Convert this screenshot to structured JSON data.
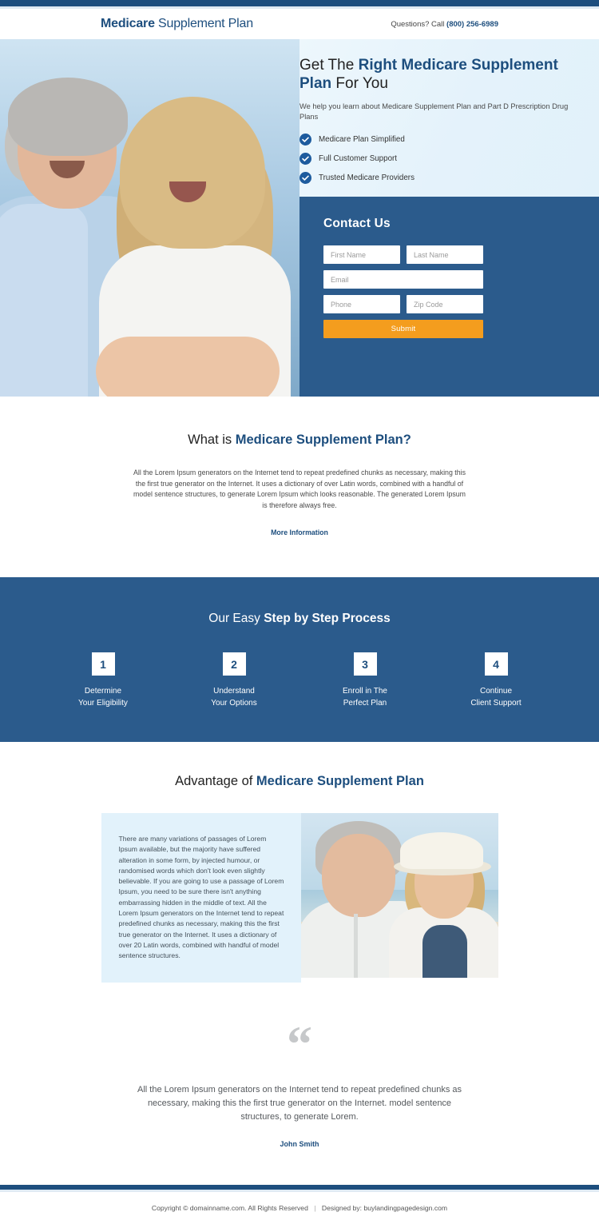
{
  "header": {
    "logo_bold": "Medicare",
    "logo_light": " Supplement Plan",
    "phone_prefix": "Questions? Call ",
    "phone_number": "(800) 256-6989"
  },
  "hero": {
    "title_part1": "Get The ",
    "title_highlight1": "Right Medicare Supplement Plan",
    "title_part2": " For You",
    "subtitle": "We help you learn about Medicare Supplement Plan and Part D Prescription Drug Plans",
    "bullets": [
      {
        "label": "Medicare Plan Simplified",
        "icon": "check-circle-icon"
      },
      {
        "label": "Full Customer Support",
        "icon": "check-circle-icon"
      },
      {
        "label": "Trusted Medicare Providers",
        "icon": "check-circle-icon"
      }
    ],
    "photo_alt": "senior-couple-smiling-photo"
  },
  "form": {
    "title": "Contact Us",
    "first_name_placeholder": "First Name",
    "last_name_placeholder": "Last Name",
    "email_placeholder": "Email",
    "phone_placeholder": "Phone",
    "zip_placeholder": "Zip Code",
    "first_name_value": "",
    "last_name_value": "",
    "email_value": "",
    "phone_value": "",
    "zip_value": "",
    "submit_label": "Submit"
  },
  "whatis": {
    "title_part1": "What is ",
    "title_highlight": "Medicare Supplement Plan?",
    "body": "All the Lorem Ipsum generators on the Internet tend to repeat predefined chunks as necessary, making this the first true generator on the Internet. It uses a dictionary of over Latin words, combined with a handful of model sentence structures, to generate Lorem Ipsum which looks reasonable. The generated Lorem Ipsum is therefore always free.",
    "more_link": "More Information"
  },
  "steps": {
    "title_part1": "Our Easy ",
    "title_highlight": "Step by Step Process",
    "items": [
      {
        "number": "1",
        "line1": "Determine",
        "line2": "Your Eligibility"
      },
      {
        "number": "2",
        "line1": "Understand",
        "line2": "Your Options"
      },
      {
        "number": "3",
        "line1": "Enroll in The",
        "line2": "Perfect Plan"
      },
      {
        "number": "4",
        "line1": "Continue",
        "line2": "Client Support"
      }
    ]
  },
  "advantage": {
    "title_part1": "Advantage of ",
    "title_highlight": "Medicare Supplement Plan",
    "body": "There are many variations of passages of Lorem Ipsum available, but the majority have suffered alteration in some form, by injected humour, or randomised words which don't look even slightly believable. If you are going to use a passage of Lorem Ipsum, you need to be sure there isn't anything embarrassing hidden in the middle of text. All the Lorem Ipsum generators on the Internet tend to repeat predefined chunks as necessary, making this the first true generator on the Internet. It uses a dictionary of over 20 Latin words, combined with  handful of model sentence structures.",
    "photo_alt": "senior-couple-beach-photo"
  },
  "testimonial": {
    "quote_mark": "“",
    "text": "All the Lorem Ipsum generators on the Internet tend to repeat predefined chunks as necessary, making this the first true generator on the Internet. model sentence structures, to generate Lorem.",
    "author": "John Smith"
  },
  "footer": {
    "copyright": "Copyright © domainname.com. All Rights Reserved",
    "separator": "|",
    "designed_by": "Designed by: buylandingpagedesign.com"
  },
  "colors": {
    "primary_blue": "#2b5b8c",
    "dark_blue": "#1d4e7e",
    "accent_orange": "#f49d1e",
    "light_blue_bg": "#e2f2fb"
  }
}
